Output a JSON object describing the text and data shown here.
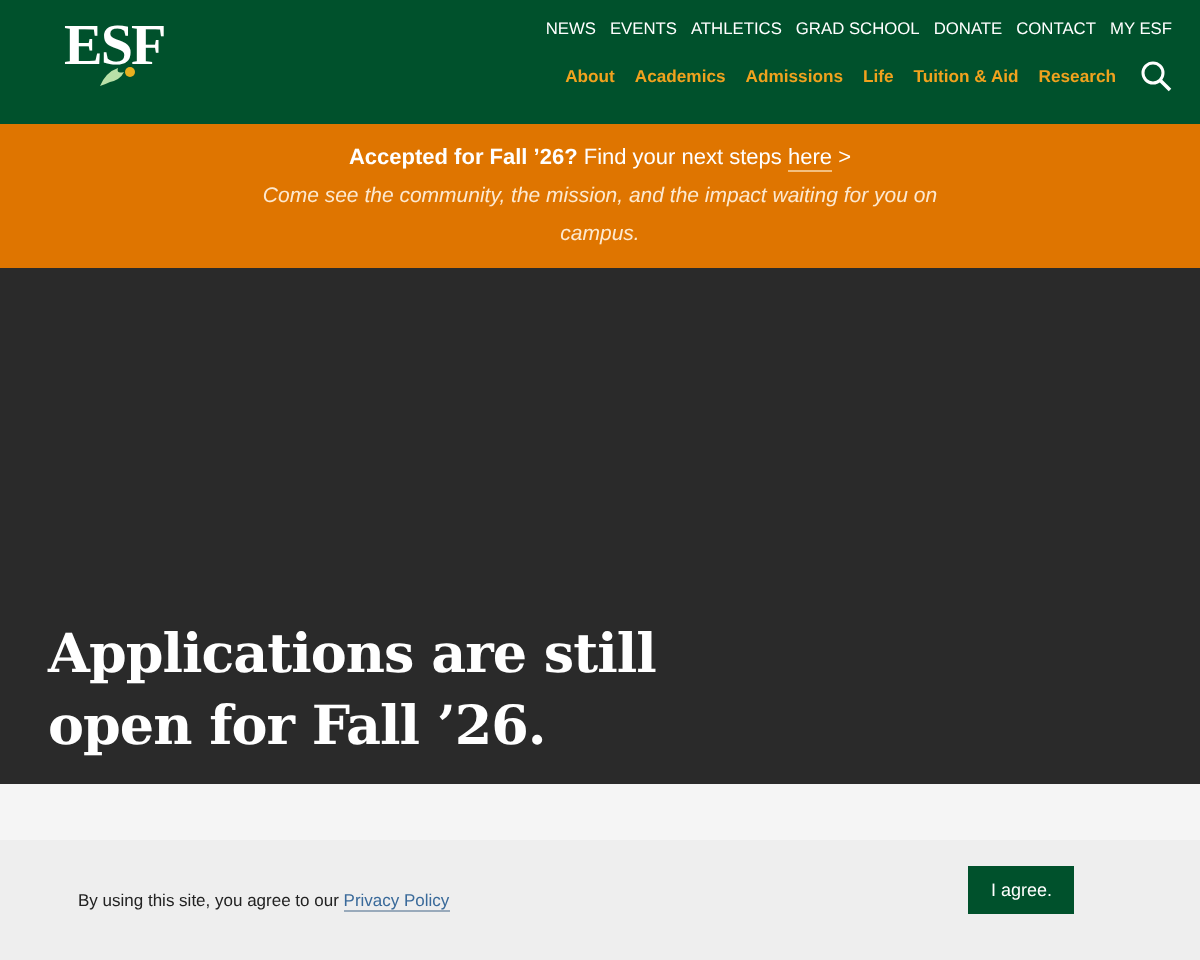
{
  "header": {
    "logo": "ESF",
    "utility_nav": [
      "NEWS",
      "EVENTS",
      "ATHLETICS",
      "GRAD SCHOOL",
      "DONATE",
      "CONTACT",
      "MY ESF"
    ],
    "main_nav": [
      "About",
      "Academics",
      "Admissions",
      "Life",
      "Tuition & Aid",
      "Research"
    ]
  },
  "banner": {
    "lead": "**Accepted for Fall ’26?** Find your next steps",
    "link": "here",
    "arrow": ">",
    "subtitle": "Come see the community, the mission, and the impact waiting for you on campus."
  },
  "hero": {
    "heading": "Applications are still open for Fall ’26."
  },
  "cookie_bar": {
    "text": "By using this site, you agree to our",
    "link": "Privacy Policy",
    "button": "I agree."
  }
}
